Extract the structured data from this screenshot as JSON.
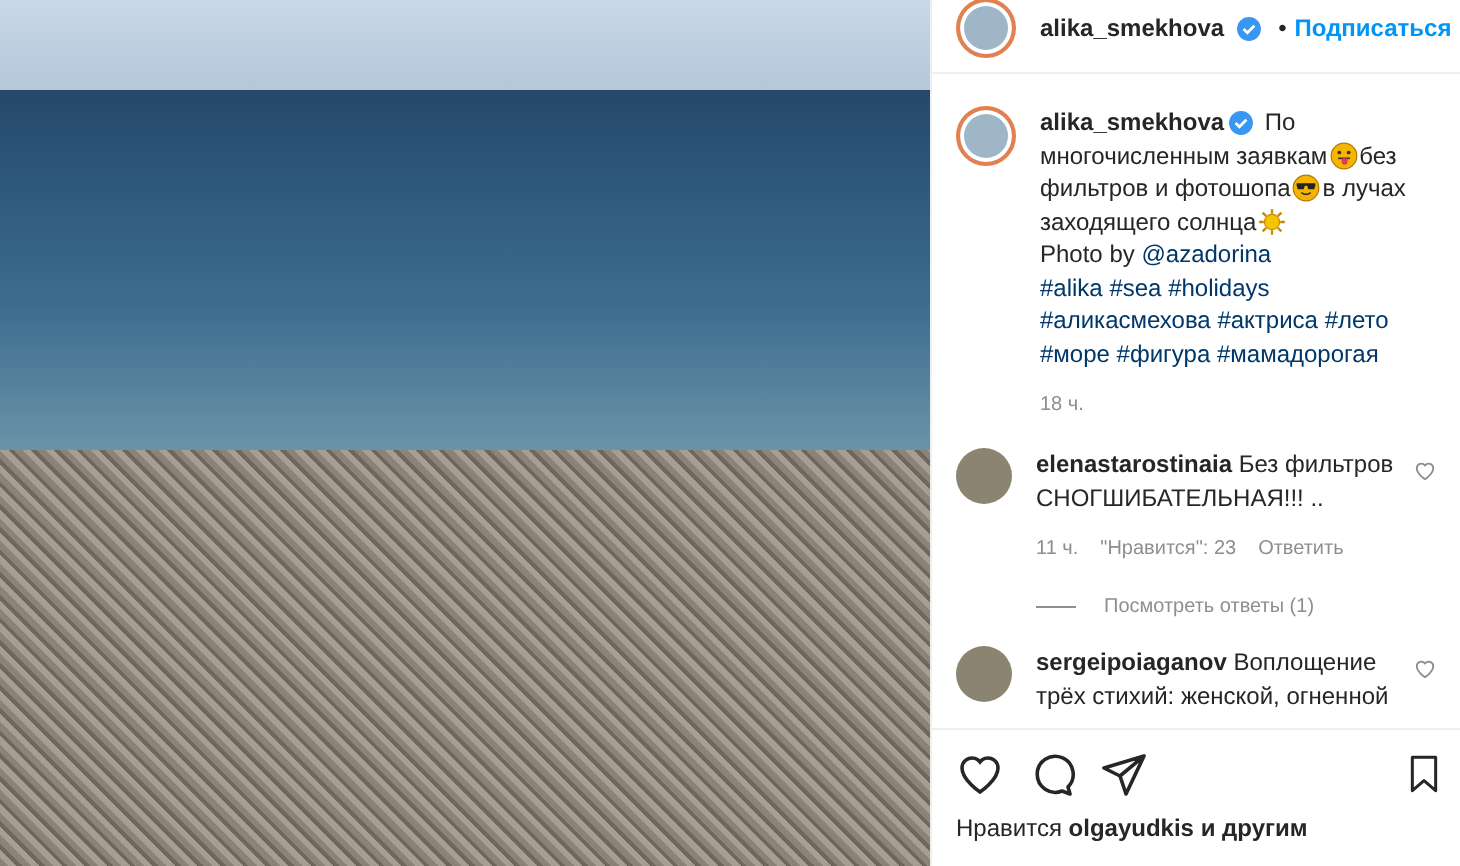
{
  "post_header": {
    "username": "alika_smekhova",
    "verified": true,
    "separator": "•",
    "follow_label": "Подписаться"
  },
  "caption": {
    "username": "alika_smekhova",
    "verified": true,
    "segments": [
      {
        "kind": "text",
        "text": "По многочисленным заявкам"
      },
      {
        "kind": "tongue-emoji"
      },
      {
        "kind": "text",
        "text": "без фильтров и фотошопа"
      },
      {
        "kind": "sunglasses-emoji"
      },
      {
        "kind": "text",
        "text": "в лучах заходящего солнца"
      },
      {
        "kind": "sun-emoji"
      }
    ],
    "credit_prefix": "Photo by",
    "credit_mention": "@azadorina",
    "hashtag_lines": [
      [
        "#alika",
        "#sea",
        "#holidays"
      ],
      [
        "#аликасмехова",
        "#актриса",
        "#лето"
      ],
      [
        "#море",
        "#фигура",
        "#мамадорогая"
      ]
    ],
    "time": "18 ч."
  },
  "comments": [
    {
      "username": "elenastarostinaia",
      "text": "Без фильтров СНОГШИБАТЕЛЬНАЯ!!! ..",
      "time": "11 ч.",
      "likes": "\"Нравится\": 23",
      "reply_label": "Ответить",
      "view_replies": "Посмотреть ответы (1)",
      "liked": false
    },
    {
      "username": "sergeipoiaganov",
      "text": "Воплощение трёх стихий: женской, огненной",
      "liked": false
    }
  ],
  "likes_line": {
    "prefix": "Нравится",
    "user": "olgayudkis",
    "suffix": "и другим"
  }
}
